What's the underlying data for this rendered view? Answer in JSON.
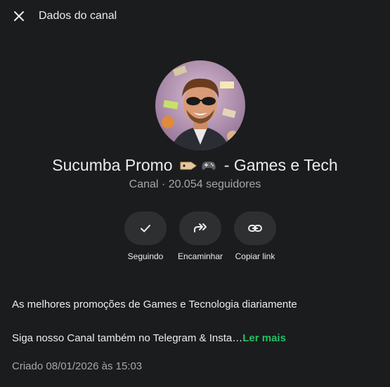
{
  "header": {
    "title": "Dados do canal",
    "close_icon": "close-icon"
  },
  "channel": {
    "name_part1": "Sucumba Promo",
    "name_emojis": "🏷️🎮",
    "name_part2": "- Games e Tech",
    "type": "Canal",
    "separator": "·",
    "followers": "20.054 seguidores"
  },
  "actions": [
    {
      "label": "Seguindo",
      "icon": "check-icon"
    },
    {
      "label": "Encaminhar",
      "icon": "forward-icon"
    },
    {
      "label": "Copiar link",
      "icon": "link-icon"
    }
  ],
  "description": {
    "line1": "As melhores promoções de Games e Tecnologia diariamente",
    "line2": "Siga nosso Canal também no Telegram & Insta…",
    "read_more": "Ler mais"
  },
  "created": "Criado 08/01/2026 às 15:03",
  "colors": {
    "background": "#1b1c1d",
    "accent": "#21c063",
    "button_bg": "#2e2f30",
    "muted_text": "#a4a8ab"
  }
}
